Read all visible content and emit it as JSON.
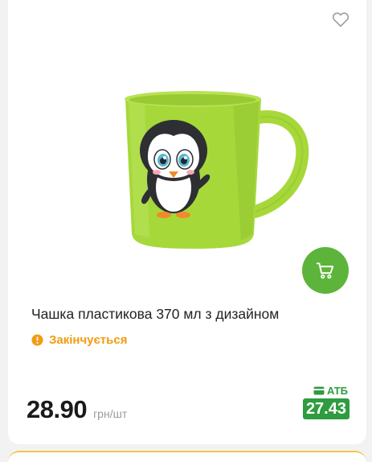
{
  "product": {
    "title": "Чашка пластикова 370 мл з дизайном",
    "status": "Закінчується",
    "price": "28.90",
    "unit": "грн/шт",
    "atb_label": "АТБ",
    "atb_price": "27.43"
  },
  "icons": {
    "favorite": "heart-outline-icon",
    "cart": "cart-icon",
    "status": "alert-circle-icon",
    "atb": "card-icon"
  },
  "colors": {
    "cart_button": "#5cb53a",
    "status": "#f39c12",
    "atb_green": "#2e9c3f",
    "mug_green": "#a6d83a"
  }
}
